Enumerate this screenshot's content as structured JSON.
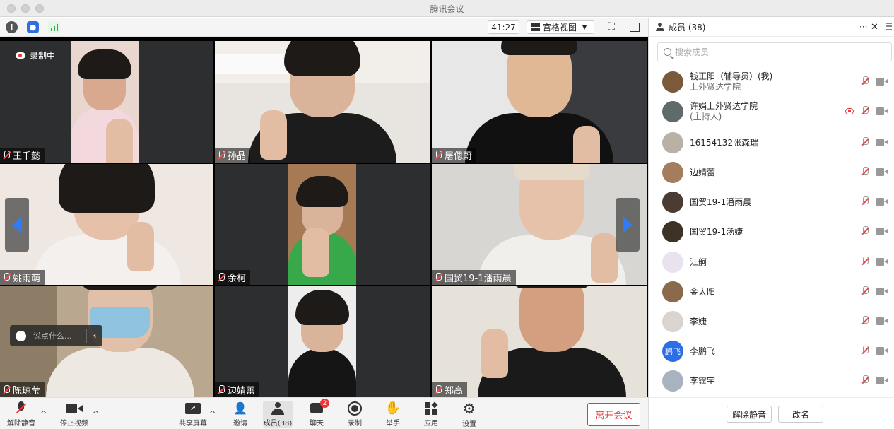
{
  "window": {
    "title": "腾讯会议"
  },
  "toolbar": {
    "timer": "41:27",
    "view_label": "宫格视图"
  },
  "recording": {
    "label": "录制中"
  },
  "video": {
    "tiles": [
      {
        "name": "王千懿"
      },
      {
        "name": "孙晶"
      },
      {
        "name": "屠偲蔚"
      },
      {
        "name": "姚雨萌"
      },
      {
        "name": "余柯"
      },
      {
        "name": "国贸19-1潘雨晨"
      },
      {
        "name": "陈琼莹"
      },
      {
        "name": "边婧蕾"
      },
      {
        "name": "郑高"
      }
    ],
    "chat_placeholder": "说点什么..."
  },
  "bottombar": {
    "unmute": "解除静音",
    "stop_video": "停止视频",
    "share": "共享屏幕",
    "invite": "邀请",
    "members": "成员(38)",
    "chat": "聊天",
    "chat_badge": "2",
    "record": "录制",
    "raise_hand": "举手",
    "apps": "应用",
    "settings": "设置",
    "leave": "离开会议"
  },
  "panel": {
    "title": "成员 (38)",
    "more": "···",
    "close": "✕",
    "search_placeholder": "搜索成员",
    "members": [
      {
        "name": "钱正阳（辅导员）(我)",
        "sub": "上外贤达学院",
        "avatar_color": "#7a5a3a"
      },
      {
        "name": "许娟上外贤达学院",
        "sub": "(主持人)",
        "avatar_color": "#5f6b6a"
      },
      {
        "name": "16154132张森瑞",
        "sub": "",
        "avatar_color": "#b9b0a6"
      },
      {
        "name": "边婧蕾",
        "sub": "",
        "avatar_color": "#a47d5e"
      },
      {
        "name": "国贸19-1潘雨晨",
        "sub": "",
        "avatar_color": "#4a3b33"
      },
      {
        "name": "国贸19-1汤婕",
        "sub": "",
        "avatar_color": "#3e3126"
      },
      {
        "name": "江舸",
        "sub": "",
        "avatar_color": "#e9e2ef"
      },
      {
        "name": "金太阳",
        "sub": "",
        "avatar_color": "#8b6a4b"
      },
      {
        "name": "李婕",
        "sub": "",
        "avatar_color": "#d9d4cf"
      },
      {
        "name": "李鹏飞",
        "sub": "",
        "avatar_text": "鹏飞",
        "avatar_color": "#2d6ee8"
      },
      {
        "name": "李霆宇",
        "sub": "",
        "avatar_color": "#a8b3bf"
      }
    ],
    "unmute_button": "解除静音",
    "rename_button": "改名"
  }
}
